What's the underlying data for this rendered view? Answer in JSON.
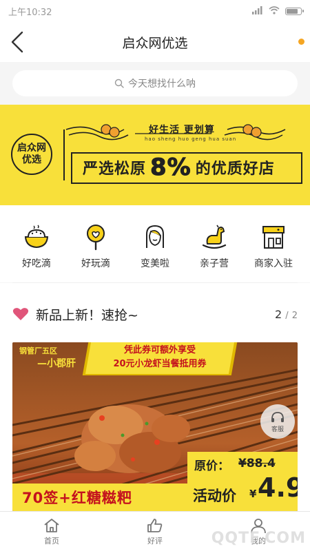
{
  "status_bar": {
    "time": "上午10:32",
    "battery_level": 0.85
  },
  "nav": {
    "title": "启众网优选"
  },
  "search": {
    "placeholder": "今天想找什么呐"
  },
  "banner": {
    "logo_line1": "启众网",
    "logo_line2": "优选",
    "slogan": "好生活 更划算",
    "pinyin": "hao sheng huo   geng hua suan",
    "headline_pre": "严选松原",
    "headline_big": "8%",
    "headline_post": "的优质好店",
    "colors": {
      "background": "#f8e03a",
      "text": "#222222"
    }
  },
  "categories": [
    {
      "label": "好吃滴",
      "icon": "rice-bowl-icon"
    },
    {
      "label": "好玩滴",
      "icon": "lollipop-icon"
    },
    {
      "label": "变美啦",
      "icon": "woman-face-icon"
    },
    {
      "label": "亲子营",
      "icon": "rocking-horse-icon"
    },
    {
      "label": "商家入驻",
      "icon": "storefront-icon"
    }
  ],
  "section": {
    "title": "新品上新！速抢~",
    "page_current": "2",
    "page_sep": "/",
    "page_total": "2",
    "heart_color": "#e0557a"
  },
  "promo": {
    "location": "钢管厂五区",
    "shop": "—小郡肝",
    "voucher_line1": "凭此券可额外享受",
    "voucher_line2": "20元小龙虾当餐抵用券",
    "deal": "70签+红糖糍粑",
    "orig_label": "原价：",
    "orig_price": "¥88.4",
    "act_label": "活动价",
    "act_currency": "¥",
    "act_price": "4.9",
    "cs_label": "客服"
  },
  "tabbar": [
    {
      "label": "首页",
      "icon": "home-icon"
    },
    {
      "label": "好评",
      "icon": "thumbs-up-icon"
    },
    {
      "label": "我的",
      "icon": "user-icon"
    }
  ],
  "watermark": "QQTF.COM"
}
